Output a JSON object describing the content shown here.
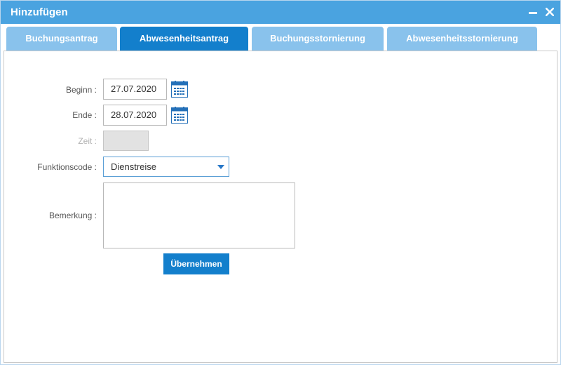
{
  "window": {
    "title": "Hinzufügen",
    "minimize_icon": "minimize-icon",
    "close_icon": "close-icon"
  },
  "tabs": [
    {
      "label": "Buchungsantrag",
      "active": false
    },
    {
      "label": "Abwesenheitsantrag",
      "active": true
    },
    {
      "label": "Buchungsstornierung",
      "active": false
    },
    {
      "label": "Abwesenheitsstornierung",
      "active": false
    }
  ],
  "form": {
    "begin": {
      "label": "Beginn :",
      "value": "27.07.2020",
      "icon": "calendar-icon"
    },
    "end": {
      "label": "Ende :",
      "value": "28.07.2020",
      "icon": "calendar-icon"
    },
    "time": {
      "label": "Zeit :",
      "value": ""
    },
    "function_code": {
      "label": "Funktionscode :",
      "value": "Dienstreise"
    },
    "remark": {
      "label": "Bemerkung :",
      "value": ""
    },
    "submit_label": "Übernehmen"
  },
  "colors": {
    "titlebar": "#4aa3e0",
    "tab_active": "#137fcc",
    "tab_inactive": "#89c2ec",
    "button": "#137fcc"
  }
}
